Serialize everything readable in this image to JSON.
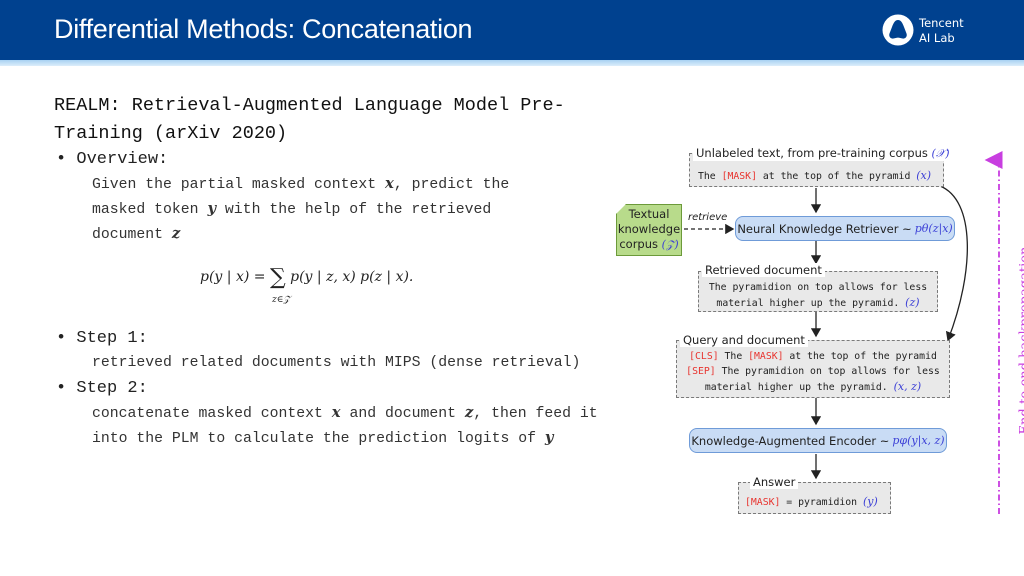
{
  "header": {
    "title": "Differential Methods: Concatenation",
    "logo_line1": "Tencent",
    "logo_line2": "AI Lab"
  },
  "content": {
    "heading_line1": "REALM: Retrieval-Augmented Language Model Pre-",
    "heading_line2": "Training (arXiv 2020)",
    "overview_label": "• Overview:",
    "overview_text": {
      "p1": "Given the partial masked context ",
      "v1": "x",
      "p2": ", predict the",
      "p3": "masked token ",
      "v2": "y",
      "p4": " with the help of the retrieved",
      "p5": "document ",
      "v3": "z"
    },
    "formula": {
      "lhs": "p(y | x) = ",
      "sum": "∑",
      "rhs": "p(y | z, x) p(z | x).",
      "subscript": "z∈𝒵"
    },
    "step1_label": "• Step 1:",
    "step1_text": "retrieved related documents with MIPS (dense retrieval)",
    "step2_label": "• Step 2:",
    "step2_text": {
      "p1": "concatenate masked context ",
      "v1": "x",
      "p2": " and document ",
      "v2": "z",
      "p3": ", then feed it",
      "p4": "into the PLM to calculate the prediction logits of ",
      "v3": "y"
    }
  },
  "diagram": {
    "input_box": {
      "label": "Unlabeled text, from pre-training corpus",
      "label_var": "(𝒳)",
      "text_pre": "The ",
      "mask": "[MASK]",
      "text_post": " at the top of the pyramid ",
      "var": "(x)"
    },
    "corpus_box": {
      "line1": "Textual",
      "line2": "knowledge",
      "line3": "corpus ",
      "var": "(𝒵)"
    },
    "retrieve_label": "retrieve",
    "retriever_box": {
      "label": "Neural Knowledge Retriever ~ ",
      "var": "pθ(z|x)"
    },
    "retrieved_box": {
      "label": "Retrieved document",
      "line1": "The pyramidion on top allows for less",
      "line2": "material higher up the pyramid. ",
      "var": "(z)"
    },
    "query_box": {
      "label": "Query and document",
      "cls": "[CLS]",
      "line1_a": " The ",
      "mask": "[MASK]",
      "line1_b": " at the top of the pyramid",
      "sep": "[SEP]",
      "line2": " The pyramidion on top allows for less",
      "line3": "material higher up the pyramid. ",
      "var": "(x, z)"
    },
    "encoder_box": {
      "label": "Knowledge-Augmented Encoder ~ ",
      "var": "pφ(y|x, z)"
    },
    "answer_box": {
      "label": "Answer",
      "mask": "[MASK]",
      "text": " = pyramidion ",
      "var": "(y)"
    },
    "backprop_label": "End-to-end backpropagation",
    "colors": {
      "header": "#00418f",
      "blue_box": "#c9dcf5",
      "green_box": "#b8db8b",
      "gray_box": "#e9e9e9",
      "mask_red": "#e8332e",
      "var_blue": "#3b3fd6",
      "backprop_magenta": "#c83ee0"
    }
  }
}
